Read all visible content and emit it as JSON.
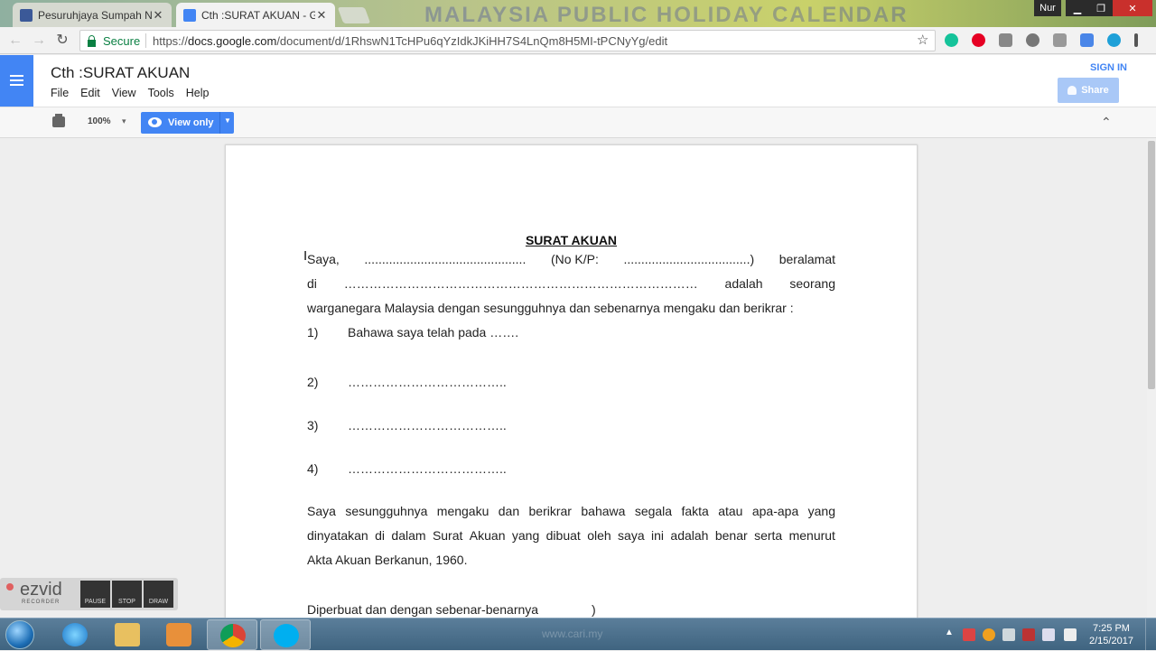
{
  "browser": {
    "tabs": [
      {
        "label": "Pesuruhjaya Sumpah Nu",
        "icon": "facebook-icon",
        "color": "#3b5998"
      },
      {
        "label": "Cth :SURAT AKUAN - Go",
        "icon": "docs-icon",
        "color": "#4285f4"
      }
    ],
    "window_user": "Nur",
    "secure_label": "Secure",
    "url_prefix": "https://",
    "url_host": "docs.google.com",
    "url_path": "/document/d/1RhswN1TcHPu6qYzIdkJKiHH7S4LnQm8H5MI-tPCNyYg/edit",
    "background_text": "MALAYSIA PUBLIC HOLIDAY CALENDAR"
  },
  "docs": {
    "title": "Cth :SURAT AKUAN",
    "menu": [
      "File",
      "Edit",
      "View",
      "Tools",
      "Help"
    ],
    "signin_label": "SIGN IN",
    "share_label": "Share",
    "zoom": "100%",
    "view_mode": "View only",
    "accent": "#4285f4"
  },
  "document": {
    "heading": "SURAT AKUAN",
    "line1": [
      "Saya,",
      "..............................................",
      "(No K/P:",
      "....................................)",
      "beralamat"
    ],
    "line2": [
      "di",
      "…………………………………………………………………………",
      "adalah",
      "seorang"
    ],
    "line3": "warganegara Malaysia dengan sesungguhnya dan sebenarnya mengaku dan berikrar :",
    "items": [
      {
        "num": "1)",
        "text": "Bahawa saya telah pada ……."
      },
      {
        "num": "2)",
        "text": "……………………………….."
      },
      {
        "num": "3)",
        "text": "……………………………….."
      },
      {
        "num": "4)",
        "text": "……………………………….."
      }
    ],
    "para_line1": [
      "Saya",
      "sesungguhnya",
      "mengaku",
      "dan",
      "berikrar",
      "bahawa",
      "segala",
      "fakta",
      "atau",
      "apa-apa",
      "yang"
    ],
    "para_line2": [
      "dinyatakan",
      "di",
      "dalam",
      "Surat",
      "Akuan",
      "yang",
      "dibuat",
      "oleh",
      "saya",
      "ini",
      "adalah",
      "benar",
      "serta",
      "menurut"
    ],
    "para_line3": "Akta Akuan Berkanun, 1960.",
    "closing_line": "Diperbuat dan dengan sebenar-benarnya",
    "closing_paren": ")"
  },
  "recorder": {
    "brand": "ezvid",
    "sub": "RECORDER",
    "buttons": [
      "PAUSE",
      "STOP",
      "DRAW"
    ]
  },
  "taskbar": {
    "time": "7:25 PM",
    "date": "2/15/2017",
    "watermark": "www.cari.my"
  }
}
